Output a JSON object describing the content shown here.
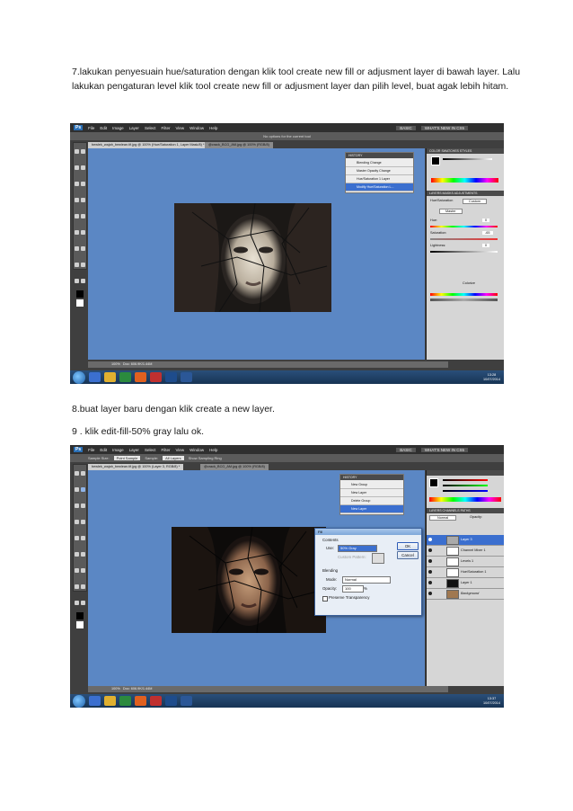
{
  "step7_text": "7.lakukan penyesuain hue/saturation dengan klik tool create new fill or adjusment layer di bawah layer. Lalu lakukan pengaturan level klik tool create new fill or adjusment layer dan pilih level, buat agak lebih hitam.",
  "step8_text": "8.buat layer baru dengan klik create a new layer.",
  "step9_text": "9 . klik edit-fill-50% gray lalu ok.",
  "screenshot1": {
    "menu": [
      "File",
      "Edit",
      "Image",
      "Layer",
      "Select",
      "Filter",
      "View",
      "Window",
      "Help"
    ],
    "workspace_buttons": [
      "BASIC",
      "WHAT'S NEW IN CS5"
    ],
    "options_text": "No options for the current tool",
    "doc_tabs": [
      "bewlek_wajah_bewlean.tif.jpg @ 100% (Hue/Saturation 1, Layer Mask/8) *",
      "@crack_BCG_AM.jpg @ 100% (RGB/8)"
    ],
    "history_title": "HISTORY",
    "history_items": [
      "Blending Change",
      "Master Opacity Change",
      "Hue/Saturation 1 Layer",
      "Modify Hue/Saturation L..."
    ],
    "adjust_tabs": [
      "COLOR",
      "SWATCHES",
      "STYLES"
    ],
    "masks_tabs": [
      "LAYERS",
      "MASKS",
      "ADJUSTMENTS"
    ],
    "hs_label": "Hue/Saturation",
    "hs_preset": "Custom",
    "hs_channel": "Master",
    "hs_hue": "Hue:",
    "hs_hue_val": "0",
    "hs_sat": "Saturation:",
    "hs_sat_val": "-65",
    "hs_light": "Lightness:",
    "hs_light_val": "0",
    "hs_colorize": "Colorize",
    "zoom": "100%",
    "doc_info": "Doc: 606.9K/1.44M",
    "clock_time": "13:28",
    "clock_date": "10/07/2014"
  },
  "screenshot2": {
    "menu": [
      "File",
      "Edit",
      "Image",
      "Layer",
      "Select",
      "Filter",
      "View",
      "Window",
      "Help"
    ],
    "workspace_buttons": [
      "BASIC",
      "WHAT'S NEW IN CS5"
    ],
    "options_sample_label": "Sample Size:",
    "options_sample_value": "Point Sample",
    "options_sample2_label": "Sample:",
    "options_sample2_value": "All Layers",
    "options_ring": "Show Sampling Ring",
    "doc_tabs": [
      "bewlek_wajah_bewlean.tif.jpg @ 100% (Layer 3, RGB/8) *",
      "@crack_BCG_AM.jpg @ 100% (RGB/8)"
    ],
    "history_title": "HISTORY",
    "history_items": [
      "New Group",
      "New Layer",
      "Delete Group",
      "New Layer"
    ],
    "layers_tabs": [
      "LAYERS",
      "CHANNELS",
      "PATHS"
    ],
    "blend_mode": "Normal",
    "opacity_label": "Opacity:",
    "layers": [
      "Layer 3",
      "Channel Mixer 1",
      "Levels 1",
      "Hue/Saturation 1",
      "Layer 1",
      "Background"
    ],
    "dialog": {
      "title": "Fill",
      "contents_label": "Contents",
      "use_label": "Use:",
      "use_value": "50% Gray",
      "custom_pattern_label": "Custom Pattern:",
      "blending_label": "Blending",
      "mode_label": "Mode:",
      "mode_value": "Normal",
      "opacity_label": "Opacity:",
      "opacity_value": "100",
      "opacity_unit": "%",
      "preserve_label": "Preserve Transparency",
      "ok_label": "OK",
      "cancel_label": "Cancel"
    },
    "zoom": "100%",
    "doc_info": "Doc: 606.9K/1.44M",
    "clock_time": "13:37",
    "clock_date": "10/07/2014"
  },
  "colors": {
    "canvas_blue": "#5b87c4",
    "dark_ui": "#3f3f3f",
    "selection_blue": "#3b6fcf"
  }
}
